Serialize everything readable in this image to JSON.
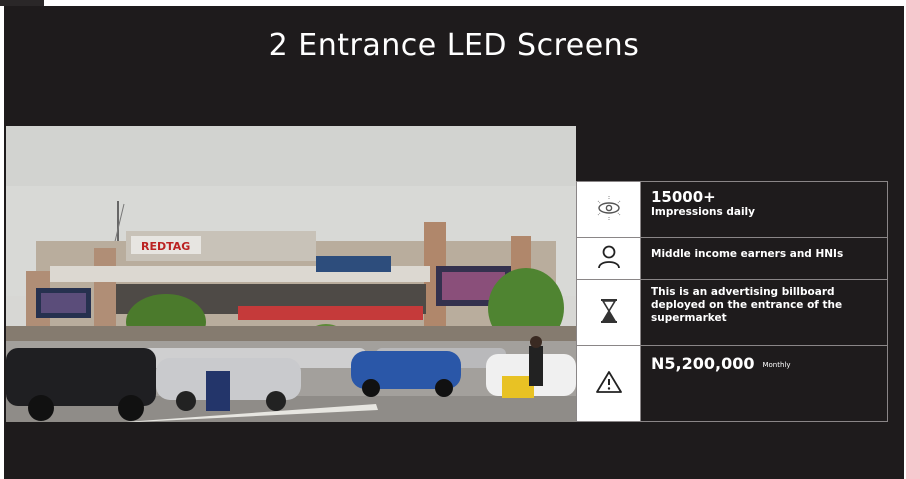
{
  "slide": {
    "title": "2 Entrance LED Screens"
  },
  "photo": {
    "signs": {
      "main_sign": "REDTAG"
    }
  },
  "info": {
    "impressions": {
      "value": "15000+",
      "label": "Impressions daily",
      "icon": "eye-icon"
    },
    "audience": {
      "label": "Middle income earners and HNIs",
      "icon": "person-icon"
    },
    "description": {
      "label": "This is an advertising billboard deployed on the entrance  of the supermarket",
      "icon": "hourglass-icon"
    },
    "price": {
      "value": "N5,200,000",
      "unit": "Monthly",
      "icon": "warning-icon"
    }
  },
  "colors": {
    "background": "#1e1b1c",
    "accent_strip": "#f6c9cf",
    "text": "#ffffff",
    "border": "#8a8687"
  }
}
